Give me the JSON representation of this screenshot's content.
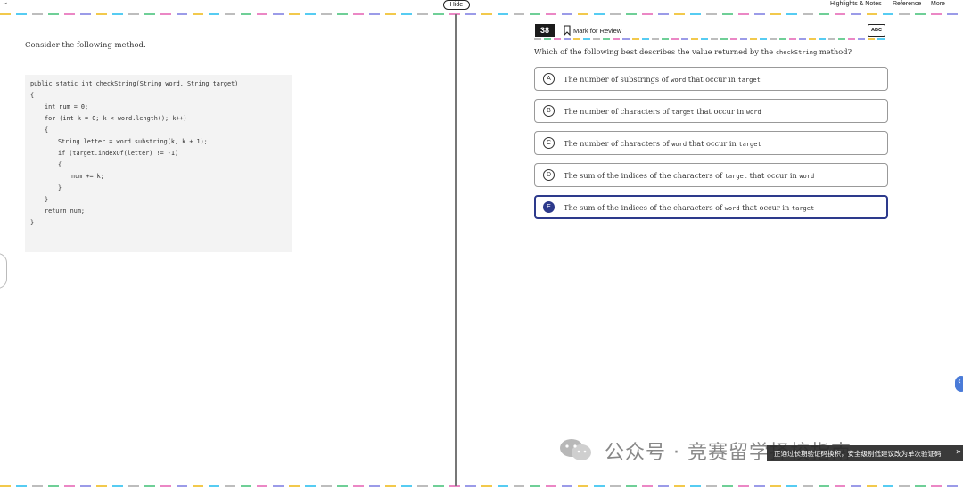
{
  "header": {
    "chevron_glyph": "⌄",
    "hide_label": "Hide",
    "highlights_label": "Highlights & Notes",
    "reference_label": "Reference",
    "more_label": "More"
  },
  "left": {
    "intro": "Consider the following method.",
    "code": [
      "public static int checkString(String word, String target)",
      "{",
      "int num = 0;",
      "for (int k = 0; k < word.length(); k++)",
      "{",
      "String letter = word.substring(k, k + 1);",
      "if (target.indexOf(letter) != -1)",
      "{",
      "num += k;",
      "}",
      "}",
      "return num;",
      "}"
    ]
  },
  "question": {
    "number": "38",
    "mark_label": "Mark for Review",
    "abc_label": "ABC",
    "stem_pre": "Which of the following best describes the value returned by the",
    "stem_code": "checkString",
    "stem_post": "method?",
    "options": [
      {
        "letter": "A",
        "pre": "The number of substrings of",
        "code1": "word",
        "mid": "that occur in",
        "code2": "target",
        "selected": false
      },
      {
        "letter": "B",
        "pre": "The number of characters of",
        "code1": "target",
        "mid": "that occur in",
        "code2": "word",
        "selected": false
      },
      {
        "letter": "C",
        "pre": "The number of characters of",
        "code1": "word",
        "mid": "that occur in",
        "code2": "target",
        "selected": false
      },
      {
        "letter": "D",
        "pre": "The sum of the indices of the characters of",
        "code1": "target",
        "mid": "that occur in",
        "code2": "word",
        "selected": false
      },
      {
        "letter": "E",
        "pre": "The sum of the indices of the characters of",
        "code1": "word",
        "mid": "that occur in",
        "code2": "target",
        "selected": true
      }
    ]
  },
  "watermark": {
    "text": "公众号 · 竞赛留学择校指南",
    "bar_text": "正通过长期验证码换积，安全级别低建议改为单次验证码",
    "bar_arrow": "»"
  },
  "colors": {
    "selected_accent": "#2d3a8c",
    "dash_palette": [
      "#f2c94c",
      "#56ccf2",
      "#bdbdbd",
      "#6fcf97",
      "#eb87c5",
      "#9b9be8"
    ]
  }
}
